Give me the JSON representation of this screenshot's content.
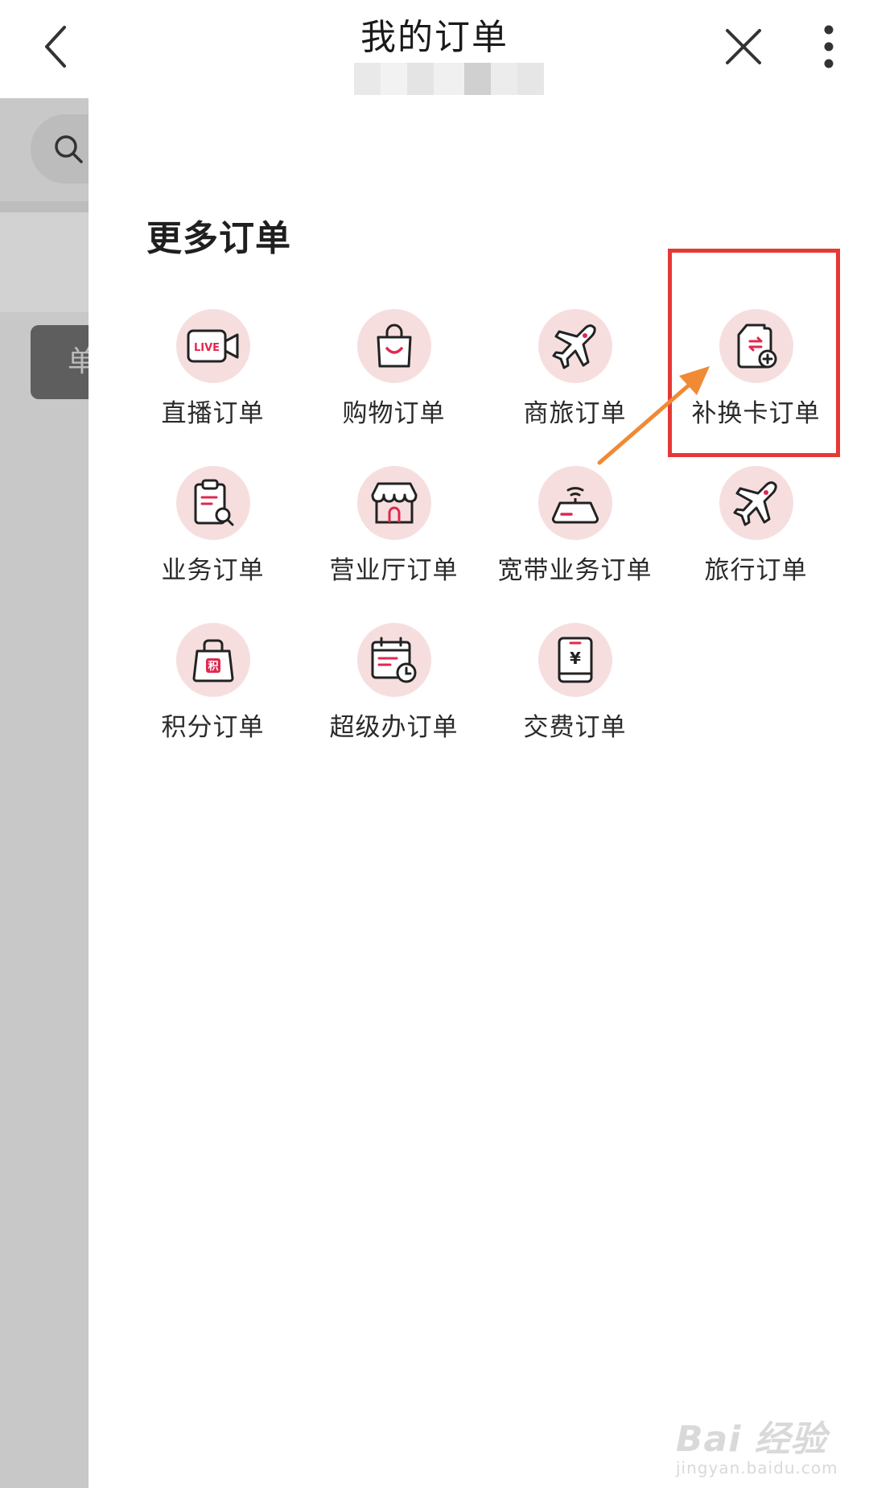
{
  "header": {
    "title": "我的订单",
    "subtitle": "",
    "back_icon": "chevron-left-icon",
    "close_icon": "close-icon",
    "more_icon": "more-vertical-icon"
  },
  "background": {
    "chip_text": "单"
  },
  "panel": {
    "title": "更多订单",
    "items": [
      {
        "label": "直播订单",
        "icon": "live-camera-icon"
      },
      {
        "label": "购物订单",
        "icon": "shopping-bag-icon"
      },
      {
        "label": "商旅订单",
        "icon": "airplane-icon"
      },
      {
        "label": "补换卡订单",
        "icon": "sim-card-swap-icon"
      },
      {
        "label": "业务订单",
        "icon": "clipboard-search-icon"
      },
      {
        "label": "营业厅订单",
        "icon": "storefront-icon"
      },
      {
        "label": "宽带业务订单",
        "icon": "router-icon"
      },
      {
        "label": "旅行订单",
        "icon": "airplane-icon"
      },
      {
        "label": "积分订单",
        "icon": "points-bag-icon"
      },
      {
        "label": "超级办订单",
        "icon": "calendar-clock-icon"
      },
      {
        "label": "交费订单",
        "icon": "payment-yuan-icon"
      }
    ],
    "live_badge": "LIVE",
    "points_glyph": "积",
    "yuan_glyph": "¥"
  },
  "annotation": {
    "highlighted_item": "补换卡订单",
    "highlight_color": "#e53935",
    "arrow_color": "#f08a35"
  },
  "watermark": {
    "logo": "Bai 经验",
    "url": "jingyan.baidu.com"
  },
  "colors": {
    "icon_bg": "#f7dede",
    "icon_stroke": "#222222",
    "icon_accent": "#e0284f"
  }
}
